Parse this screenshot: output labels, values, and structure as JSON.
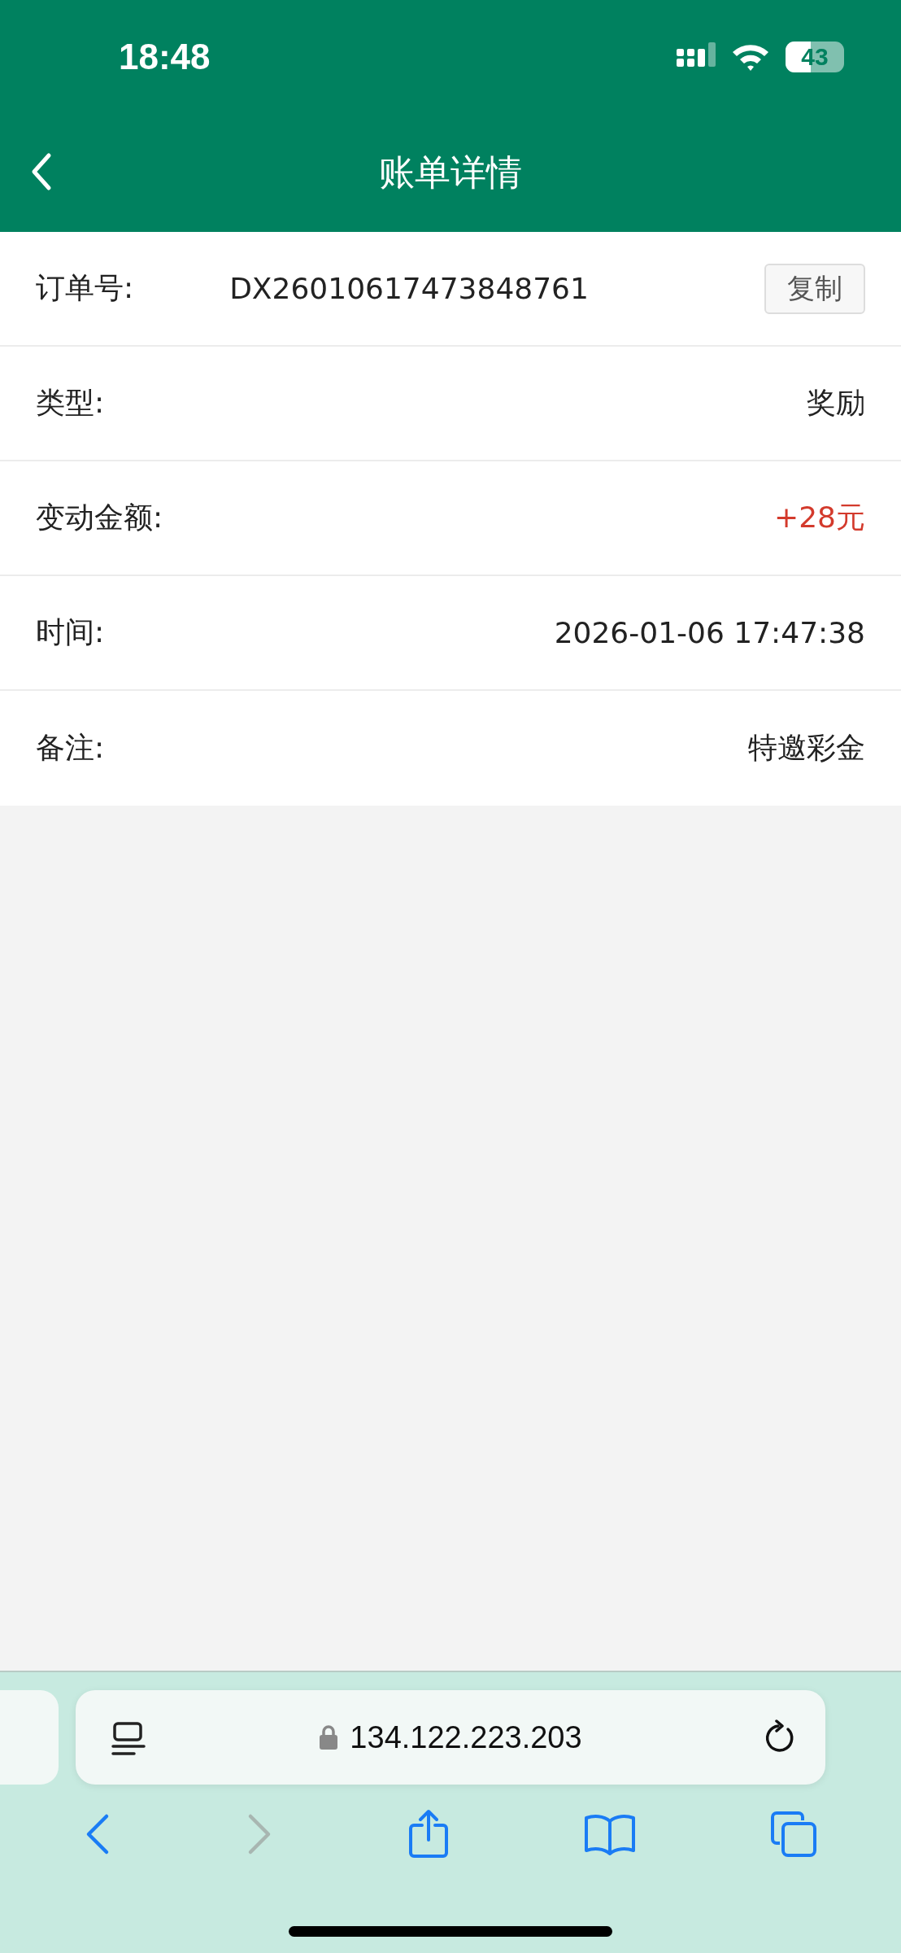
{
  "status_bar": {
    "time": "18:48",
    "battery": "43"
  },
  "header": {
    "title": "账单详情"
  },
  "rows": [
    {
      "kind": "copy",
      "label": "订单号:",
      "value": "DX26010617473848761",
      "button": "复制"
    },
    {
      "kind": "plain",
      "label": "类型:",
      "value": "奖励"
    },
    {
      "kind": "amount",
      "label": "变动金额:",
      "value": "+28元"
    },
    {
      "kind": "plain",
      "label": "时间:",
      "value": "2026-01-06 17:47:38"
    },
    {
      "kind": "plain",
      "label": "备注:",
      "value": "特邀彩金"
    }
  ],
  "browser": {
    "address": "134.122.223.203",
    "forward_disabled": true
  }
}
